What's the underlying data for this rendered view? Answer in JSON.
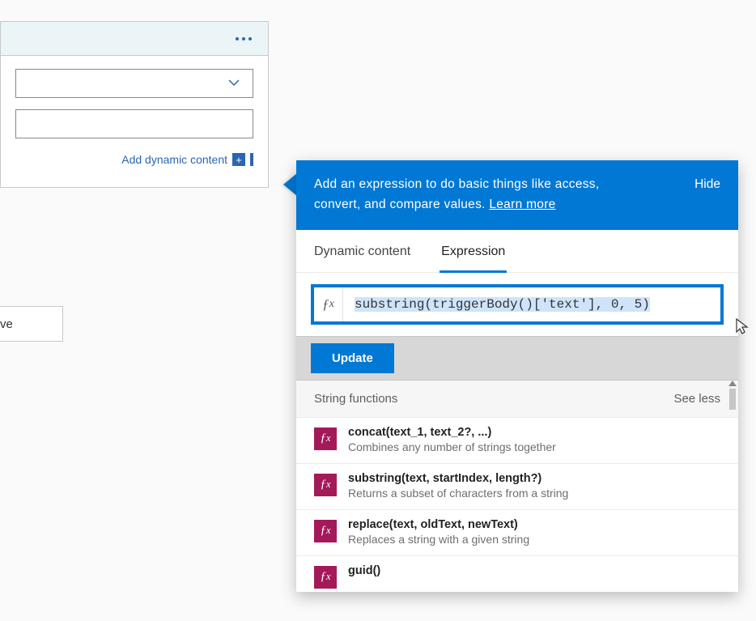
{
  "card": {
    "add_dynamic_label": "Add dynamic content"
  },
  "save_fragment": "ve",
  "popover": {
    "banner_text_1": "Add an expression to do basic things like access,",
    "banner_text_2": "convert, and compare values.",
    "learn_more": "Learn more",
    "hide": "Hide",
    "tabs": {
      "dynamic": "Dynamic content",
      "expression": "Expression"
    },
    "fx_symbol": "fx",
    "expression_value": "substring(triggerBody()['text'], 0, 5)",
    "update_label": "Update",
    "section_title": "String functions",
    "see_less": "See less",
    "functions": [
      {
        "sig": "concat(text_1, text_2?, ...)",
        "desc": "Combines any number of strings together"
      },
      {
        "sig": "substring(text, startIndex, length?)",
        "desc": "Returns a subset of characters from a string"
      },
      {
        "sig": "replace(text, oldText, newText)",
        "desc": "Replaces a string with a given string"
      },
      {
        "sig": "guid()",
        "desc": ""
      }
    ]
  }
}
